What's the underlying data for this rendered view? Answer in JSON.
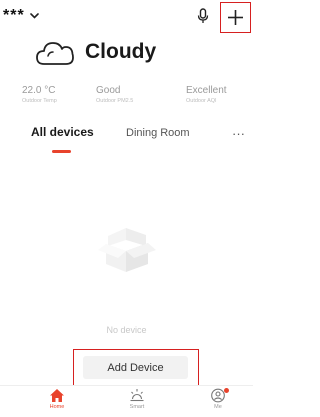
{
  "header": {
    "home_name": "***",
    "chevron_icon": "chevron-down-icon",
    "mic_icon": "microphone-icon",
    "add_icon": "plus-icon"
  },
  "weather": {
    "icon": "cloud-icon",
    "condition": "Cloudy"
  },
  "metrics": [
    {
      "value": "22.0 °C",
      "label": "Outdoor Temp"
    },
    {
      "value": "Good",
      "label": "Outdoor PM2.5"
    },
    {
      "value": "Excellent",
      "label": "Outdoor AQI"
    }
  ],
  "tabs": {
    "items": [
      {
        "label": "All devices",
        "active": true
      },
      {
        "label": "Dining Room",
        "active": false
      }
    ],
    "more_label": "···"
  },
  "empty_state": {
    "icon": "empty-box-icon",
    "message": "No device",
    "button_label": "Add Device"
  },
  "bottom_nav": [
    {
      "label": "Home",
      "icon": "home-icon",
      "active": true
    },
    {
      "label": "Smart",
      "icon": "smart-sun-icon",
      "active": false
    },
    {
      "label": "Me",
      "icon": "profile-icon",
      "active": false
    }
  ],
  "colors": {
    "accent": "#e8432c",
    "highlight_box": "#d62020",
    "muted_text": "#9a9a9a"
  }
}
